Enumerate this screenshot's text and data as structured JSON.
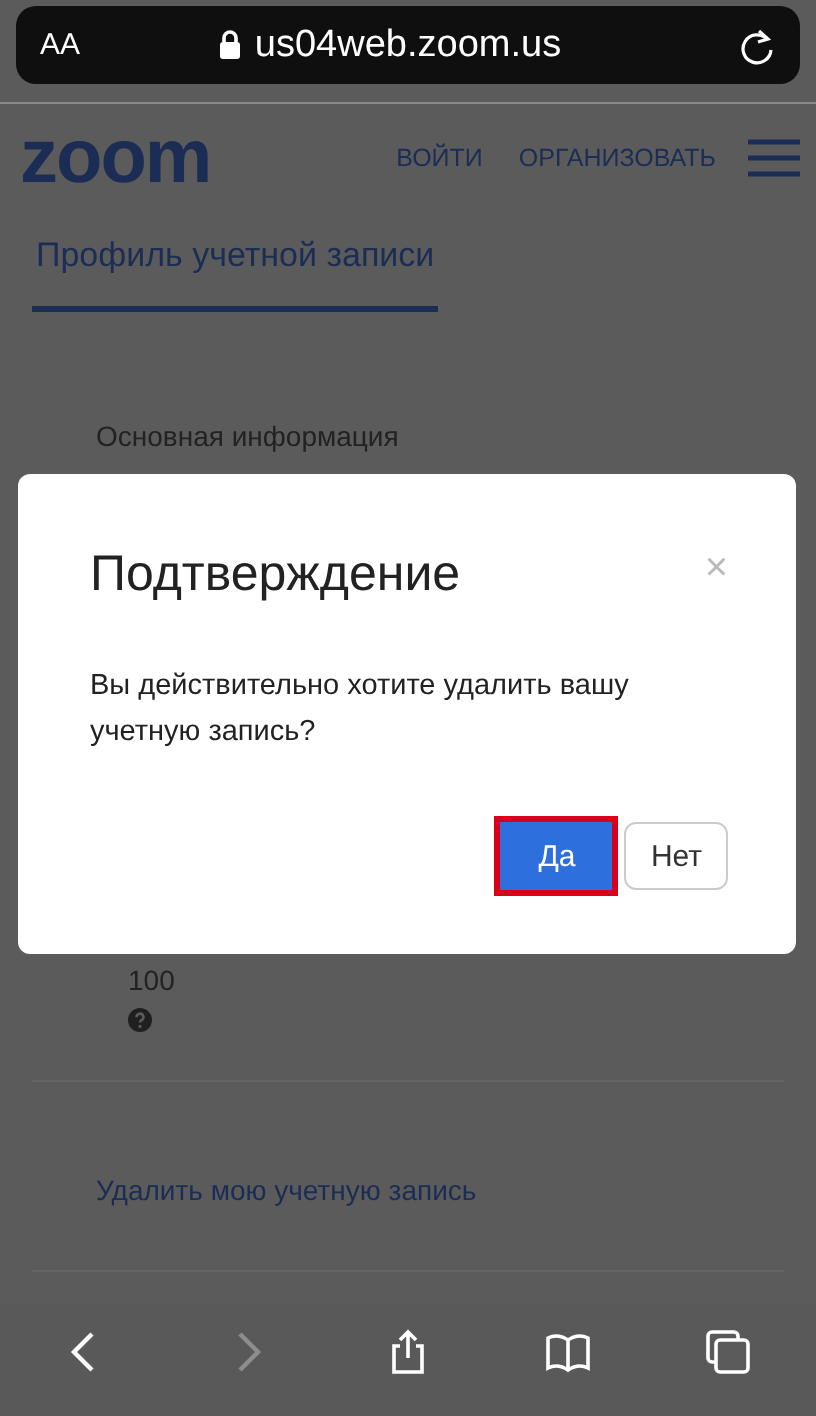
{
  "browser": {
    "text_size_button": "AA",
    "url": "us04web.zoom.us"
  },
  "header": {
    "logo": "zoom",
    "nav": [
      "ВОЙТИ",
      "ОРГАНИЗОВАТЬ"
    ]
  },
  "tabs": [
    {
      "label": "Профиль учетной записи",
      "selected": true
    }
  ],
  "section_heading": "Основная информация",
  "field_value": "100",
  "delete_link": "Удалить мою учетную запись",
  "dialog": {
    "title": "Подтверждение",
    "close": "×",
    "message": "Вы действительно хотите удалить вашу учетную запись?",
    "buttons": [
      {
        "label": "Да",
        "kind": "primary",
        "highlighted": true
      },
      {
        "label": "Нет",
        "kind": "secondary",
        "highlighted": false
      }
    ]
  },
  "toolbar": [
    {
      "kind": "back",
      "disabled": false
    },
    {
      "kind": "forward",
      "disabled": true
    },
    {
      "kind": "share",
      "disabled": false
    },
    {
      "kind": "bookmarks",
      "disabled": false
    },
    {
      "kind": "tabs",
      "disabled": false
    }
  ]
}
